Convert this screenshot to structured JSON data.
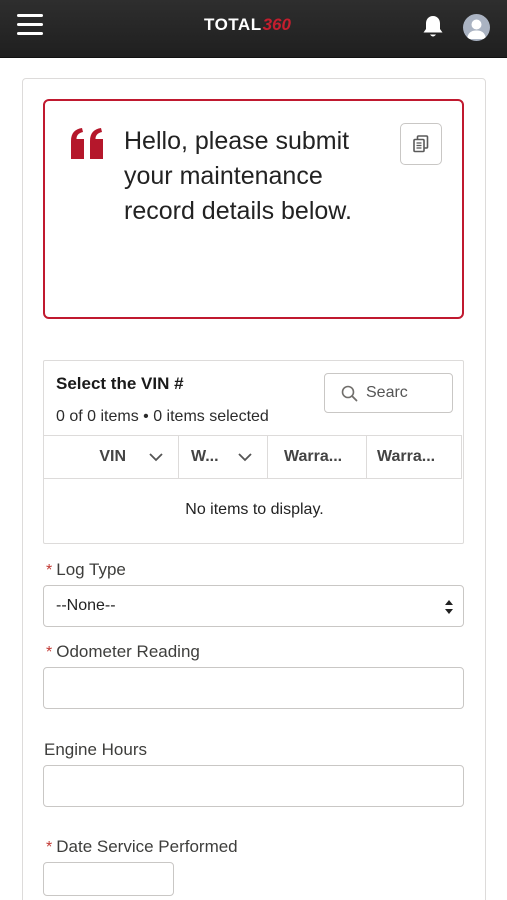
{
  "header": {
    "logo_primary": "TOTAL",
    "logo_secondary": "360",
    "brand_color": "#c41e2e",
    "icons": [
      "menu-icon",
      "bell-icon",
      "user-avatar-icon"
    ]
  },
  "message": {
    "text": "Hello, please submit your maintenance record details below.",
    "accent_color": "#c0192f",
    "icons": [
      "quote-icon",
      "copy-icon"
    ]
  },
  "vin_table": {
    "title": "Select the VIN #",
    "count_text": "0 of 0 items • 0 items selected",
    "search_placeholder": "Searc",
    "columns": [
      {
        "label": "VIN"
      },
      {
        "label": "W..."
      },
      {
        "label": "Warra..."
      },
      {
        "label": "Warra..."
      }
    ],
    "empty_text": "No items to display."
  },
  "form": {
    "required_marker": "*",
    "log_type": {
      "label": "Log Type",
      "required": true,
      "selected": "--None--"
    },
    "odometer": {
      "label": "Odometer Reading",
      "required": true,
      "value": ""
    },
    "engine_hours": {
      "label": "Engine Hours",
      "required": false,
      "value": ""
    },
    "date_service": {
      "label": "Date Service Performed",
      "required": true,
      "value": ""
    }
  }
}
